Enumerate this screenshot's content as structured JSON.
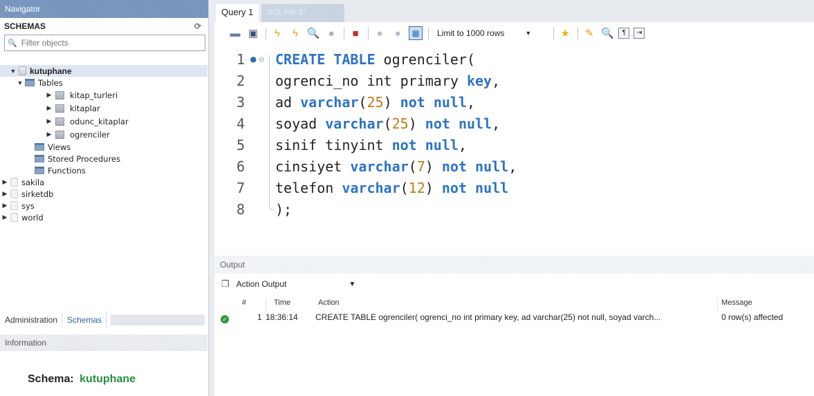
{
  "navigator": {
    "title": "Navigator",
    "schemas_label": "SCHEMAS",
    "filter_placeholder": "Filter objects",
    "tree": {
      "kutuphane": "kutuphane",
      "tables": "Tables",
      "table_items": [
        "kitap_turleri",
        "kitaplar",
        "odunc_kitaplar",
        "ogrenciler"
      ],
      "views": "Views",
      "stored_procedures": "Stored Procedures",
      "functions": "Functions",
      "other_schemas": [
        "sakila",
        "sirketdb",
        "sys",
        "world"
      ]
    },
    "tabs": [
      "Administration",
      "Schemas"
    ],
    "information_label": "Information",
    "schema_info_label": "Schema:",
    "schema_info_value": "kutuphane"
  },
  "editor_tabs": [
    "Query 1",
    "SQL File 2*"
  ],
  "toolbar": {
    "limit_label": "Limit to 1000 rows",
    "icons": [
      "folder-open-icon",
      "save-icon",
      "execute-icon",
      "execute-current-icon",
      "explain-icon",
      "stop-icon",
      "toggle-error-icon",
      "commit-icon",
      "rollback-icon",
      "autocommit-icon",
      "beautify-icon",
      "find-icon",
      "invisible-chars-icon",
      "wrap-icon"
    ]
  },
  "editor": {
    "line_numbers": [
      "1",
      "2",
      "3",
      "4",
      "5",
      "6",
      "7",
      "8"
    ],
    "lines": [
      [
        {
          "t": "CREATE TABLE",
          "c": "kw"
        },
        {
          "t": " ogrenciler(",
          "c": ""
        }
      ],
      [
        {
          "t": "ogrenci_no int primary ",
          "c": ""
        },
        {
          "t": "key",
          "c": "kw"
        },
        {
          "t": ",",
          "c": ""
        }
      ],
      [
        {
          "t": "ad ",
          "c": ""
        },
        {
          "t": "varchar",
          "c": "kw"
        },
        {
          "t": "(",
          "c": ""
        },
        {
          "t": "25",
          "c": "num"
        },
        {
          "t": ") ",
          "c": ""
        },
        {
          "t": "not null",
          "c": "kw"
        },
        {
          "t": ",",
          "c": ""
        }
      ],
      [
        {
          "t": "soyad ",
          "c": ""
        },
        {
          "t": "varchar",
          "c": "kw"
        },
        {
          "t": "(",
          "c": ""
        },
        {
          "t": "25",
          "c": "num"
        },
        {
          "t": ") ",
          "c": ""
        },
        {
          "t": "not null",
          "c": "kw"
        },
        {
          "t": ",",
          "c": ""
        }
      ],
      [
        {
          "t": "sinif tinyint ",
          "c": ""
        },
        {
          "t": "not null",
          "c": "kw"
        },
        {
          "t": ",",
          "c": ""
        }
      ],
      [
        {
          "t": "cinsiyet ",
          "c": ""
        },
        {
          "t": "varchar",
          "c": "kw"
        },
        {
          "t": "(",
          "c": ""
        },
        {
          "t": "7",
          "c": "num"
        },
        {
          "t": ") ",
          "c": ""
        },
        {
          "t": "not null",
          "c": "kw"
        },
        {
          "t": ",",
          "c": ""
        }
      ],
      [
        {
          "t": "telefon ",
          "c": ""
        },
        {
          "t": "varchar",
          "c": "kw"
        },
        {
          "t": "(",
          "c": ""
        },
        {
          "t": "12",
          "c": "num"
        },
        {
          "t": ") ",
          "c": ""
        },
        {
          "t": "not null",
          "c": "kw"
        }
      ],
      [
        {
          "t": ");",
          "c": ""
        }
      ]
    ]
  },
  "output": {
    "header": "Output",
    "mode": "Action Output",
    "columns": {
      "num": "#",
      "time": "Time",
      "action": "Action",
      "message": "Message"
    },
    "rows": [
      {
        "num": "1",
        "time": "18:36:14",
        "action": "CREATE TABLE ogrenciler( ogrenci_no int primary key, ad varchar(25) not null, soyad varch...",
        "message": "0 row(s) affected",
        "status": "success"
      }
    ]
  },
  "colors": {
    "keyword": "#2b73c8",
    "number": "#c47a1c",
    "schema_value": "#24923a",
    "success": "#2e9b3e"
  }
}
